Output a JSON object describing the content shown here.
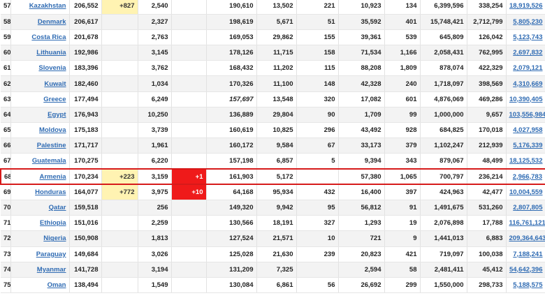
{
  "table": {
    "rows": [
      {
        "rank": "57",
        "country": "Kazakhstan",
        "total_cases": "206,552",
        "new_cases": "+827",
        "total_deaths": "2,540",
        "new_deaths": "",
        "total_recovered": "190,610",
        "active": "13,502",
        "serious": "221",
        "cases_per_1m": "10,923",
        "deaths_per_1m": "134",
        "total_tests": "6,399,596",
        "tests_per_1m": "338,254",
        "population": "18,919,526"
      },
      {
        "rank": "58",
        "country": "Denmark",
        "total_cases": "206,617",
        "new_cases": "",
        "total_deaths": "2,327",
        "new_deaths": "",
        "total_recovered": "198,619",
        "active": "5,671",
        "serious": "51",
        "cases_per_1m": "35,592",
        "deaths_per_1m": "401",
        "total_tests": "15,748,421",
        "tests_per_1m": "2,712,799",
        "population": "5,805,230"
      },
      {
        "rank": "59",
        "country": "Costa Rica",
        "total_cases": "201,678",
        "new_cases": "",
        "total_deaths": "2,763",
        "new_deaths": "",
        "total_recovered": "169,053",
        "active": "29,862",
        "serious": "155",
        "cases_per_1m": "39,361",
        "deaths_per_1m": "539",
        "total_tests": "645,809",
        "tests_per_1m": "126,042",
        "population": "5,123,743"
      },
      {
        "rank": "60",
        "country": "Lithuania",
        "total_cases": "192,986",
        "new_cases": "",
        "total_deaths": "3,145",
        "new_deaths": "",
        "total_recovered": "178,126",
        "active": "11,715",
        "serious": "158",
        "cases_per_1m": "71,534",
        "deaths_per_1m": "1,166",
        "total_tests": "2,058,431",
        "tests_per_1m": "762,995",
        "population": "2,697,832"
      },
      {
        "rank": "61",
        "country": "Slovenia",
        "total_cases": "183,396",
        "new_cases": "",
        "total_deaths": "3,762",
        "new_deaths": "",
        "total_recovered": "168,432",
        "active": "11,202",
        "serious": "115",
        "cases_per_1m": "88,208",
        "deaths_per_1m": "1,809",
        "total_tests": "878,074",
        "tests_per_1m": "422,329",
        "population": "2,079,121"
      },
      {
        "rank": "62",
        "country": "Kuwait",
        "total_cases": "182,460",
        "new_cases": "",
        "total_deaths": "1,034",
        "new_deaths": "",
        "total_recovered": "170,326",
        "active": "11,100",
        "serious": "148",
        "cases_per_1m": "42,328",
        "deaths_per_1m": "240",
        "total_tests": "1,718,097",
        "tests_per_1m": "398,569",
        "population": "4,310,669"
      },
      {
        "rank": "63",
        "country": "Greece",
        "total_cases": "177,494",
        "new_cases": "",
        "total_deaths": "6,249",
        "new_deaths": "",
        "total_recovered": "157,697",
        "active": "13,548",
        "serious": "320",
        "cases_per_1m": "17,082",
        "deaths_per_1m": "601",
        "total_tests": "4,876,069",
        "tests_per_1m": "469,286",
        "population": "10,390,405",
        "recovered_italic": true
      },
      {
        "rank": "64",
        "country": "Egypt",
        "total_cases": "176,943",
        "new_cases": "",
        "total_deaths": "10,250",
        "new_deaths": "",
        "total_recovered": "136,889",
        "active": "29,804",
        "serious": "90",
        "cases_per_1m": "1,709",
        "deaths_per_1m": "99",
        "total_tests": "1,000,000",
        "tests_per_1m": "9,657",
        "population": "103,556,984"
      },
      {
        "rank": "65",
        "country": "Moldova",
        "total_cases": "175,183",
        "new_cases": "",
        "total_deaths": "3,739",
        "new_deaths": "",
        "total_recovered": "160,619",
        "active": "10,825",
        "serious": "296",
        "cases_per_1m": "43,492",
        "deaths_per_1m": "928",
        "total_tests": "684,825",
        "tests_per_1m": "170,018",
        "population": "4,027,958"
      },
      {
        "rank": "66",
        "country": "Palestine",
        "total_cases": "171,717",
        "new_cases": "",
        "total_deaths": "1,961",
        "new_deaths": "",
        "total_recovered": "160,172",
        "active": "9,584",
        "serious": "67",
        "cases_per_1m": "33,173",
        "deaths_per_1m": "379",
        "total_tests": "1,102,247",
        "tests_per_1m": "212,939",
        "population": "5,176,339"
      },
      {
        "rank": "67",
        "country": "Guatemala",
        "total_cases": "170,275",
        "new_cases": "",
        "total_deaths": "6,220",
        "new_deaths": "",
        "total_recovered": "157,198",
        "active": "6,857",
        "serious": "5",
        "cases_per_1m": "9,394",
        "deaths_per_1m": "343",
        "total_tests": "879,067",
        "tests_per_1m": "48,499",
        "population": "18,125,532"
      },
      {
        "rank": "68",
        "country": "Armenia",
        "total_cases": "170,234",
        "new_cases": "+223",
        "total_deaths": "3,159",
        "new_deaths": "+1",
        "total_recovered": "161,903",
        "active": "5,172",
        "serious": "",
        "cases_per_1m": "57,380",
        "deaths_per_1m": "1,065",
        "total_tests": "700,797",
        "tests_per_1m": "236,214",
        "population": "2,966,783",
        "highlight": true
      },
      {
        "rank": "69",
        "country": "Honduras",
        "total_cases": "164,077",
        "new_cases": "+772",
        "total_deaths": "3,975",
        "new_deaths": "+10",
        "total_recovered": "64,168",
        "active": "95,934",
        "serious": "432",
        "cases_per_1m": "16,400",
        "deaths_per_1m": "397",
        "total_tests": "424,963",
        "tests_per_1m": "42,477",
        "population": "10,004,559"
      },
      {
        "rank": "70",
        "country": "Qatar",
        "total_cases": "159,518",
        "new_cases": "",
        "total_deaths": "256",
        "new_deaths": "",
        "total_recovered": "149,320",
        "active": "9,942",
        "serious": "95",
        "cases_per_1m": "56,812",
        "deaths_per_1m": "91",
        "total_tests": "1,491,675",
        "tests_per_1m": "531,260",
        "population": "2,807,805"
      },
      {
        "rank": "71",
        "country": "Ethiopia",
        "total_cases": "151,016",
        "new_cases": "",
        "total_deaths": "2,259",
        "new_deaths": "",
        "total_recovered": "130,566",
        "active": "18,191",
        "serious": "327",
        "cases_per_1m": "1,293",
        "deaths_per_1m": "19",
        "total_tests": "2,076,898",
        "tests_per_1m": "17,788",
        "population": "116,761,121"
      },
      {
        "rank": "72",
        "country": "Nigeria",
        "total_cases": "150,908",
        "new_cases": "",
        "total_deaths": "1,813",
        "new_deaths": "",
        "total_recovered": "127,524",
        "active": "21,571",
        "serious": "10",
        "cases_per_1m": "721",
        "deaths_per_1m": "9",
        "total_tests": "1,441,013",
        "tests_per_1m": "6,883",
        "population": "209,364,643"
      },
      {
        "rank": "73",
        "country": "Paraguay",
        "total_cases": "149,684",
        "new_cases": "",
        "total_deaths": "3,026",
        "new_deaths": "",
        "total_recovered": "125,028",
        "active": "21,630",
        "serious": "239",
        "cases_per_1m": "20,823",
        "deaths_per_1m": "421",
        "total_tests": "719,097",
        "tests_per_1m": "100,038",
        "population": "7,188,241"
      },
      {
        "rank": "74",
        "country": "Myanmar",
        "total_cases": "141,728",
        "new_cases": "",
        "total_deaths": "3,194",
        "new_deaths": "",
        "total_recovered": "131,209",
        "active": "7,325",
        "serious": "",
        "cases_per_1m": "2,594",
        "deaths_per_1m": "58",
        "total_tests": "2,481,411",
        "tests_per_1m": "45,412",
        "population": "54,642,396"
      },
      {
        "rank": "75",
        "country": "Oman",
        "total_cases": "138,494",
        "new_cases": "",
        "total_deaths": "1,549",
        "new_deaths": "",
        "total_recovered": "130,084",
        "active": "6,861",
        "serious": "56",
        "cases_per_1m": "26,692",
        "deaths_per_1m": "299",
        "total_tests": "1,550,000",
        "tests_per_1m": "298,733",
        "population": "5,188,575"
      }
    ]
  }
}
